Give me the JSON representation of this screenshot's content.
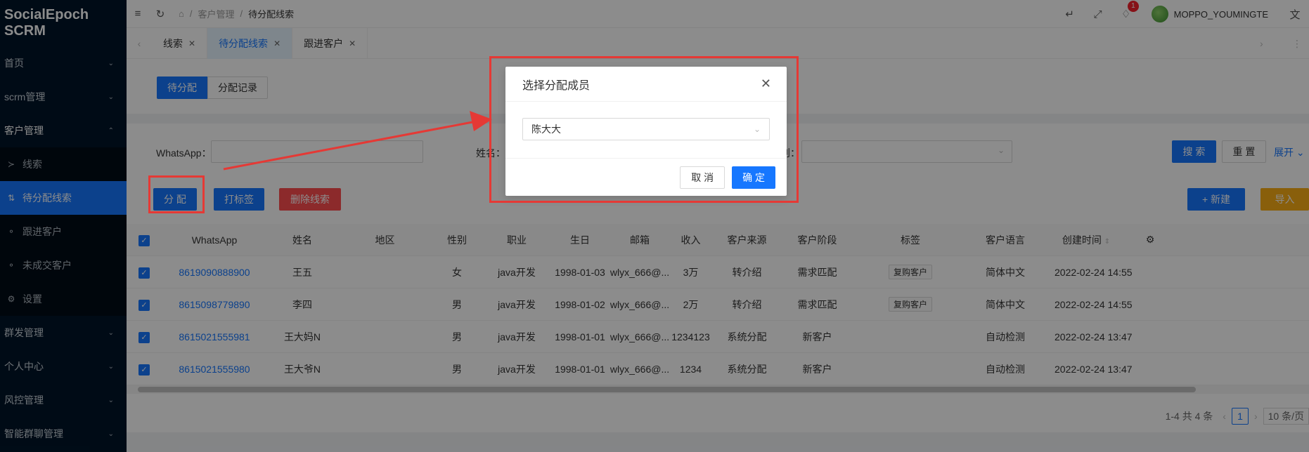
{
  "brand": "SocialEpoch SCRM",
  "sidebar": {
    "home": "首页",
    "scrm": "scrm管理",
    "customer": "客户管理",
    "sub": {
      "leads": "线索",
      "pending": "待分配线索",
      "followup": "跟进客户",
      "unclosed": "未成交客户",
      "settings": "设置"
    },
    "mass": "群发管理",
    "personal": "个人中心",
    "risk": "风控管理",
    "group": "智能群聊管理"
  },
  "header": {
    "crumb_root": "客户管理",
    "crumb_current": "待分配线索",
    "notif_count": "1",
    "username": "MOPPO_YOUMINGTE"
  },
  "tabs": [
    "线索",
    "待分配线索",
    "跟进客户"
  ],
  "segment": {
    "on": "待分配",
    "off": "分配记录"
  },
  "filters": {
    "whatsapp": "WhatsApp：",
    "name": "姓名：",
    "gender_tail": "别："
  },
  "buttons": {
    "search": "搜 索",
    "reset": "重 置",
    "expand": "展开",
    "assign": "分 配",
    "tag": "打标签",
    "delete": "删除线索",
    "new": "+ 新建",
    "import": "导入"
  },
  "table": {
    "headers": [
      "WhatsApp",
      "姓名",
      "地区",
      "性别",
      "职业",
      "生日",
      "邮箱",
      "收入",
      "客户来源",
      "客户阶段",
      "标签",
      "客户语言",
      "创建时间"
    ],
    "rows": [
      {
        "whatsapp": "8619090888900",
        "name": "王五",
        "region": "",
        "gender": "女",
        "job": "java开发",
        "birthday": "1998-01-03",
        "email": "wlyx_666@...",
        "income": "3万",
        "source": "转介绍",
        "stage": "需求匹配",
        "tag": "复购客户",
        "lang": "简体中文",
        "created": "2022-02-24 14:55"
      },
      {
        "whatsapp": "8615098779890",
        "name": "李四",
        "region": "",
        "gender": "男",
        "job": "java开发",
        "birthday": "1998-01-02",
        "email": "wlyx_666@...",
        "income": "2万",
        "source": "转介绍",
        "stage": "需求匹配",
        "tag": "复购客户",
        "lang": "简体中文",
        "created": "2022-02-24 14:55"
      },
      {
        "whatsapp": "8615021555981",
        "name": "王大妈N",
        "region": "",
        "gender": "男",
        "job": "java开发",
        "birthday": "1998-01-01",
        "email": "wlyx_666@...",
        "income": "1234123",
        "source": "系统分配",
        "stage": "新客户",
        "tag": "",
        "lang": "自动检测",
        "created": "2022-02-24 13:47"
      },
      {
        "whatsapp": "8615021555980",
        "name": "王大爷N",
        "region": "",
        "gender": "男",
        "job": "java开发",
        "birthday": "1998-01-01",
        "email": "wlyx_666@...",
        "income": "1234",
        "source": "系统分配",
        "stage": "新客户",
        "tag": "",
        "lang": "自动检测",
        "created": "2022-02-24 13:47"
      }
    ]
  },
  "pagination": {
    "total": "1-4 共 4 条",
    "page": "1",
    "size": "10 条/页"
  },
  "modal": {
    "title": "选择分配成员",
    "selected": "陈大大",
    "cancel": "取 消",
    "ok": "确 定"
  },
  "colors": {
    "primary": "#1677ff",
    "sidebar": "#001529",
    "danger": "#ff4d4f",
    "warning": "#faad14",
    "annotation": "#e53935"
  }
}
